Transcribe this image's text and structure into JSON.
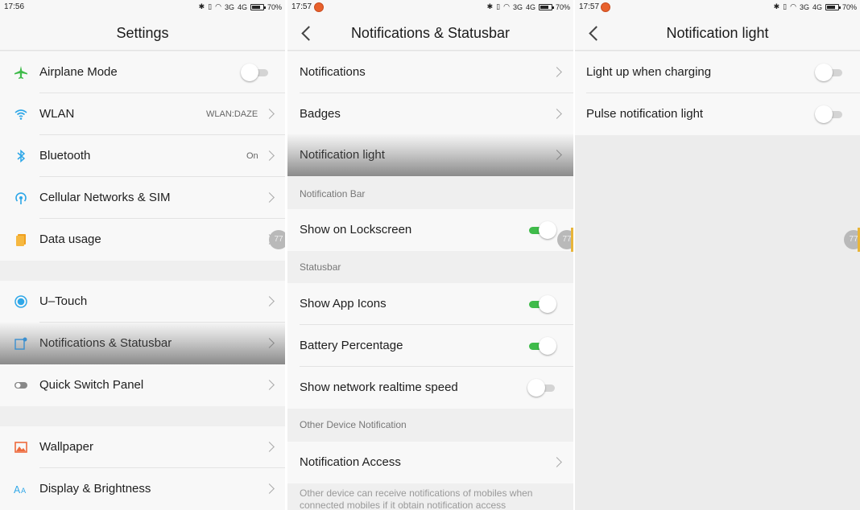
{
  "screens": [
    {
      "status": {
        "time": "17:56",
        "network1": "3G",
        "network2": "4G",
        "battery": "70%",
        "battery_level": 0.7
      },
      "title": "Settings",
      "items": [
        {
          "label": "Airplane Mode",
          "icon": "airplane-icon",
          "toggle": "off"
        },
        {
          "label": "WLAN",
          "icon": "wifi-icon",
          "value": "WLAN:DAZE"
        },
        {
          "label": "Bluetooth",
          "icon": "bluetooth-icon",
          "value": "On"
        },
        {
          "label": "Cellular Networks & SIM",
          "icon": "cellular-icon"
        },
        {
          "label": "Data usage",
          "icon": "data-usage-icon"
        },
        {
          "label": "U–Touch",
          "icon": "u-touch-icon"
        },
        {
          "label": "Notifications & Statusbar",
          "icon": "notifications-icon",
          "highlighted": true
        },
        {
          "label": "Quick Switch Panel",
          "icon": "quick-switch-icon"
        },
        {
          "label": "Wallpaper",
          "icon": "wallpaper-icon"
        },
        {
          "label": "Display & Brightness",
          "icon": "display-icon"
        }
      ],
      "float_ball": "77"
    },
    {
      "status": {
        "time": "17:57",
        "network1": "3G",
        "network2": "4G",
        "battery": "70%",
        "battery_level": 0.7
      },
      "title": "Notifications & Statusbar",
      "items": [
        {
          "label": "Notifications"
        },
        {
          "label": "Badges"
        },
        {
          "label": "Notification light",
          "highlighted": true
        }
      ],
      "sections": [
        {
          "title": "Notification Bar",
          "items": [
            {
              "label": "Show on Lockscreen",
              "toggle": "on"
            }
          ]
        },
        {
          "title": "Statusbar",
          "items": [
            {
              "label": "Show App Icons",
              "toggle": "on"
            },
            {
              "label": "Battery Percentage",
              "toggle": "on"
            },
            {
              "label": "Show network realtime speed",
              "toggle": "off"
            }
          ]
        },
        {
          "title": "Other Device Notification",
          "items": [
            {
              "label": "Notification Access"
            }
          ]
        }
      ],
      "footnote": "Other device can receive notifications of mobiles when connected mobiles if it obtain notification access",
      "float_ball": "77"
    },
    {
      "status": {
        "time": "17:57",
        "network1": "3G",
        "network2": "4G",
        "battery": "70%",
        "battery_level": 0.7
      },
      "title": "Notification light",
      "items": [
        {
          "label": "Light up when charging",
          "toggle": "off"
        },
        {
          "label": "Pulse notification light",
          "toggle": "off"
        }
      ],
      "float_ball": "77"
    }
  ],
  "colors": {
    "toggle_on": "#3fbb4a",
    "airplane": "#3fbb4a",
    "wifi": "#2ea7e8",
    "bluetooth": "#2ea7e8",
    "data_usage": "#f0a020",
    "wallpaper": "#ee6a3c"
  }
}
